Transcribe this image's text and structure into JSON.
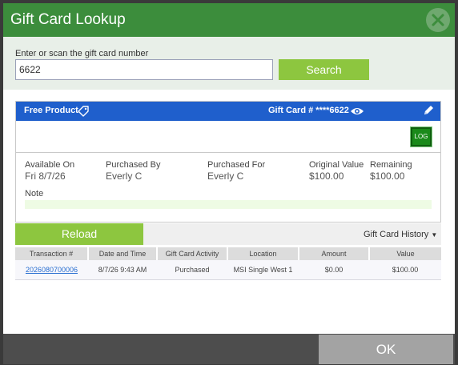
{
  "dialog": {
    "title": "Gift Card Lookup",
    "ok_label": "OK"
  },
  "search": {
    "label": "Enter or scan the gift card number",
    "value": "6622",
    "button_label": "Search"
  },
  "card": {
    "product_label": "Free Product",
    "gift_card_label": "Gift Card # ****6622",
    "log_label": "LOG",
    "fields": {
      "available_on": {
        "label": "Available On",
        "value": "Fri 8/7/26"
      },
      "purchased_by": {
        "label": "Purchased By",
        "value": "Everly C"
      },
      "purchased_for": {
        "label": "Purchased For",
        "value": "Everly C"
      },
      "original_value": {
        "label": "Original Value",
        "value": "$100.00"
      },
      "remaining": {
        "label": "Remaining",
        "value": "$100.00"
      }
    },
    "note_label": "Note"
  },
  "actions": {
    "reload_label": "Reload",
    "history_label": "Gift Card History"
  },
  "history_table": {
    "headers": [
      "Transaction #",
      "Date and Time",
      "Gift Card Activity",
      "Location",
      "Amount",
      "Value"
    ],
    "rows": [
      {
        "transaction": "2026080700006",
        "date": "8/7/26 9:43 AM",
        "activity": "Purchased",
        "location": "MSI Single West 1",
        "amount": "$0.00",
        "value": "$100.00"
      }
    ]
  },
  "colors": {
    "titlebar": "#3c8d3c",
    "accent_green": "#8dc63f",
    "card_header_blue": "#1f5fcc"
  },
  "icons": [
    "close-icon",
    "tag-icon",
    "eye-icon",
    "pencil-icon"
  ]
}
